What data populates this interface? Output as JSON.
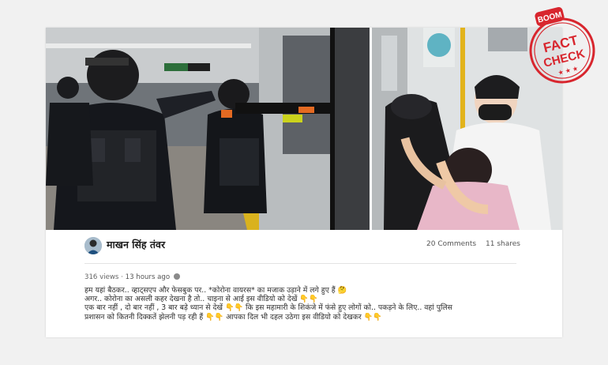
{
  "post": {
    "author": "माखन सिंह तंवर",
    "comments": "20 Comments",
    "shares": "11 shares",
    "views": "316 views",
    "time": "13 hours ago",
    "lines": [
      "हम यहां बैठकर.. व्हाट्सएप और फेसबुक पर.. *कोरोना वायरस* का मजाक उड़ाने में लगे हुए हैं 🤔",
      "अगर.. कोरोना का असली कहर देखना है तो.. चाइना से आई इस वीडियो को देखें 👇👇",
      "एक बार नहीं , दो बार नहीं , 3 बार बड़े ध्यान से देखें 👇👇 कि इस महामारी के शिकंजे में फंसे हुए लोगों को.. पकड़ने के लिए.. वहां पुलिस",
      "प्रशासन को कितनी दिक्कतें झेलनी पड़ रही हैं 👇👇 आपका दिल भी दहल उठेगा इस वीडियो को देखकर 👇👇"
    ]
  },
  "stamp": {
    "brand": "BOOM",
    "line1": "FACT",
    "line2": "CHECK"
  },
  "colors": {
    "stamp_red": "#d8262e",
    "background": "#f1f1f1"
  }
}
